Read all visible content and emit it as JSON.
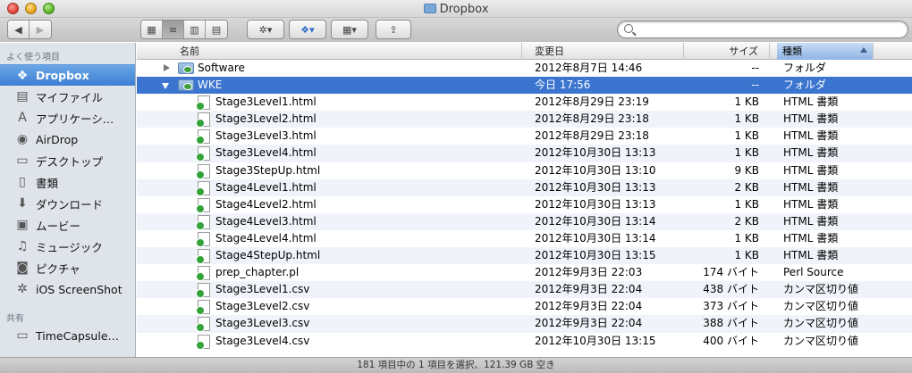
{
  "window": {
    "title": "Dropbox"
  },
  "toolbar": {
    "back_icon": "◀",
    "forward_icon": "▶",
    "view_icons": [
      "▦",
      "≡",
      "▥",
      "▤"
    ],
    "action_icon": "✲▾",
    "dropbox_icon": "❖▾",
    "arrange_icon": "▦▾",
    "share_icon": "⇪",
    "search_placeholder": ""
  },
  "sidebar": {
    "favorites_header": "よく使う項目",
    "shared_header": "共有",
    "items": [
      {
        "label": "Dropbox",
        "icon": "dropbox-icon",
        "glyph": "❖"
      },
      {
        "label": "マイファイル",
        "icon": "all-my-files-icon",
        "glyph": "▤"
      },
      {
        "label": "アプリケーシ…",
        "icon": "applications-icon",
        "glyph": "A"
      },
      {
        "label": "AirDrop",
        "icon": "airdrop-icon",
        "glyph": "◉"
      },
      {
        "label": "デスクトップ",
        "icon": "desktop-icon",
        "glyph": "▭"
      },
      {
        "label": "書類",
        "icon": "documents-icon",
        "glyph": "▯"
      },
      {
        "label": "ダウンロード",
        "icon": "downloads-icon",
        "glyph": "⬇"
      },
      {
        "label": "ムービー",
        "icon": "movies-icon",
        "glyph": "▣"
      },
      {
        "label": "ミュージック",
        "icon": "music-icon",
        "glyph": "♫"
      },
      {
        "label": "ピクチャ",
        "icon": "pictures-icon",
        "glyph": "◙"
      },
      {
        "label": "iOS ScreenShot",
        "icon": "gear-icon",
        "glyph": "✲"
      }
    ],
    "shared": [
      {
        "label": "TimeCapsule…",
        "icon": "timecapsule-icon",
        "glyph": "▭"
      }
    ]
  },
  "columns": {
    "name": "名前",
    "date": "変更日",
    "size": "サイズ",
    "kind": "種類"
  },
  "rows": [
    {
      "name": "Software",
      "date": "2012年8月7日 14:46",
      "size": "--",
      "kind": "フォルダ"
    },
    {
      "name": "WKE",
      "date": "今日 17:56",
      "size": "--",
      "kind": "フォルダ"
    },
    {
      "name": "Stage3Level1.html",
      "date": "2012年8月29日 23:19",
      "size": "1 KB",
      "kind": "HTML 書類"
    },
    {
      "name": "Stage3Level2.html",
      "date": "2012年8月29日 23:18",
      "size": "1 KB",
      "kind": "HTML 書類"
    },
    {
      "name": "Stage3Level3.html",
      "date": "2012年8月29日 23:18",
      "size": "1 KB",
      "kind": "HTML 書類"
    },
    {
      "name": "Stage3Level4.html",
      "date": "2012年10月30日 13:13",
      "size": "1 KB",
      "kind": "HTML 書類"
    },
    {
      "name": "Stage3StepUp.html",
      "date": "2012年10月30日 13:10",
      "size": "9 KB",
      "kind": "HTML 書類"
    },
    {
      "name": "Stage4Level1.html",
      "date": "2012年10月30日 13:13",
      "size": "2 KB",
      "kind": "HTML 書類"
    },
    {
      "name": "Stage4Level2.html",
      "date": "2012年10月30日 13:13",
      "size": "1 KB",
      "kind": "HTML 書類"
    },
    {
      "name": "Stage4Level3.html",
      "date": "2012年10月30日 13:14",
      "size": "2 KB",
      "kind": "HTML 書類"
    },
    {
      "name": "Stage4Level4.html",
      "date": "2012年10月30日 13:14",
      "size": "1 KB",
      "kind": "HTML 書類"
    },
    {
      "name": "Stage4StepUp.html",
      "date": "2012年10月30日 13:15",
      "size": "1 KB",
      "kind": "HTML 書類"
    },
    {
      "name": "prep_chapter.pl",
      "date": "2012年9月3日 22:03",
      "size": "174 バイト",
      "kind": "Perl Source"
    },
    {
      "name": "Stage3Level1.csv",
      "date": "2012年9月3日 22:04",
      "size": "438 バイト",
      "kind": "カンマ区切り値"
    },
    {
      "name": "Stage3Level2.csv",
      "date": "2012年9月3日 22:04",
      "size": "373 バイト",
      "kind": "カンマ区切り値"
    },
    {
      "name": "Stage3Level3.csv",
      "date": "2012年9月3日 22:04",
      "size": "388 バイト",
      "kind": "カンマ区切り値"
    },
    {
      "name": "Stage3Level4.csv",
      "date": "2012年10月30日 13:15",
      "size": "400 バイト",
      "kind": "カンマ区切り値"
    }
  ],
  "status": "181 項目中の 1 項目を選択、121.39 GB 空き"
}
